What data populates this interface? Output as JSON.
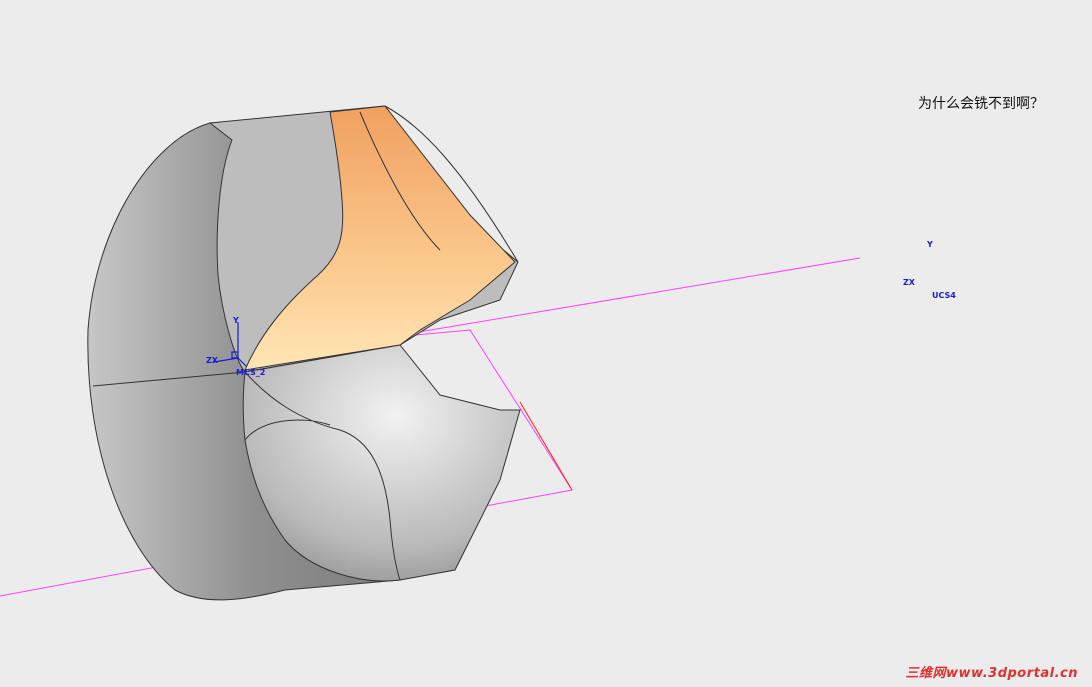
{
  "annotation": {
    "text": "为什么会铣不到啊？"
  },
  "csys_left": {
    "name": "MCS_2",
    "axis_x": "ZX",
    "axis_y": "Y"
  },
  "csys_right": {
    "name": "UCS4",
    "axis_x": "ZX",
    "axis_y": "Y"
  },
  "watermark": {
    "text": "三维网www.3dportal.cn"
  },
  "colors": {
    "background": "#ececec",
    "stock": "#9a9a9a",
    "fixture_face": "#f3b577",
    "toolpath": "#ff1a1a",
    "wireframe": "#222222",
    "work_plane": "#ff40ff",
    "csys": "#1a1ad8",
    "arrow": "#000000"
  }
}
